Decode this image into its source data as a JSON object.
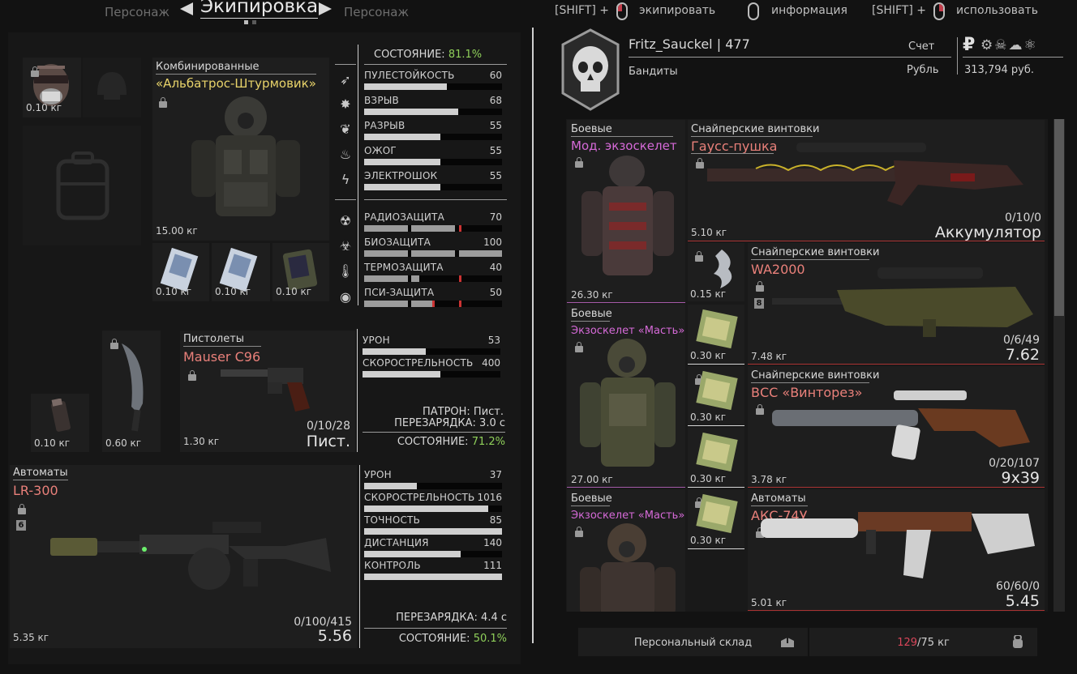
{
  "header": {
    "prev_tab": "Персонаж",
    "active_tab": "Экипировка",
    "next_tab": "Персонаж",
    "hints": [
      {
        "modifier": "[SHIFT] +",
        "label": "экипировать"
      },
      {
        "modifier": "",
        "label": "информация"
      },
      {
        "modifier": "[SHIFT] +",
        "label": "использовать"
      }
    ]
  },
  "equipment": {
    "mask_weight": "0.10 кг",
    "armor": {
      "category": "Комбинированные",
      "name": "«Альбатрос-Штурмовик»",
      "weight": "15.00 кг",
      "condition_label": "СОСТОЯНИЕ:",
      "condition_value": "81.1%",
      "stats": [
        {
          "label": "ПУЛЕСТОЙКОСТЬ",
          "value": "60",
          "fill": 0.6
        },
        {
          "label": "ВЗРЫВ",
          "value": "68",
          "fill": 0.68
        },
        {
          "label": "РАЗРЫВ",
          "value": "55",
          "fill": 0.55
        },
        {
          "label": "ОЖОГ",
          "value": "55",
          "fill": 0.55
        },
        {
          "label": "ЭЛЕКТРОШОК",
          "value": "55",
          "fill": 0.55
        }
      ],
      "protection": [
        {
          "label": "РАДИОЗАЩИТА",
          "value": "70"
        },
        {
          "label": "БИОЗАЩИТА",
          "value": "100"
        },
        {
          "label": "ТЕРМОЗАЩИТА",
          "value": "40"
        },
        {
          "label": "ПСИ-ЗАЩИТА",
          "value": "50"
        }
      ],
      "container_weights": [
        "0.10 кг",
        "0.10 кг",
        "0.10 кг"
      ]
    },
    "small_slots": {
      "grenade_weight": "0.10 кг",
      "knife_weight": "0.60 кг"
    },
    "pistol": {
      "category": "Пистолеты",
      "name": "Mauser C96",
      "weight": "1.30 кг",
      "ammo": "0/10/28",
      "caliber": "Пист.",
      "stats": [
        {
          "label": "УРОН",
          "value": "53",
          "fill": 0.46
        },
        {
          "label": "СКОРОСТРЕЛЬНОСТЬ",
          "value": "400",
          "fill": 0.56
        }
      ],
      "cartridge": "ПАТРОН: Пист.",
      "reload": "ПЕРЕЗАРЯДКА: 3.0 с",
      "condition_label": "СОСТОЯНИЕ:",
      "condition_value": "71.2%"
    },
    "rifle": {
      "category": "Автоматы",
      "name": "LR-300",
      "badge": "6",
      "weight": "5.35 кг",
      "ammo": "0/100/415",
      "caliber": "5.56",
      "stats": [
        {
          "label": "УРОН",
          "value": "37",
          "fill": 0.38
        },
        {
          "label": "СКОРОСТРЕЛЬНОСТЬ",
          "value": "1016",
          "fill": 0.9
        },
        {
          "label": "ТОЧНОСТЬ",
          "value": "85",
          "fill": 1.0
        },
        {
          "label": "ДИСТАНЦИЯ",
          "value": "140",
          "fill": 0.7
        },
        {
          "label": "КОНТРОЛЬ",
          "value": "111",
          "fill": 1.0
        }
      ],
      "reload": "ПЕРЕЗАРЯДКА: 4.4 с",
      "condition_label": "СОСТОЯНИЕ:",
      "condition_value": "50.1%"
    }
  },
  "profile": {
    "name": "Fritz_Sauckel",
    "separator": "|",
    "level": "477",
    "faction": "Бандиты",
    "account_label": "Счет",
    "currency_label": "Рубль",
    "money": "313,794 руб.",
    "currency_symbol": "₽"
  },
  "inventory": {
    "left": [
      {
        "category": "Боевые",
        "name": "Мод. экзоскелет",
        "weight": "26.30 кг"
      },
      {
        "category": "Боевые",
        "name": "Экзоскелет «Масть»",
        "weight": "27.00 кг"
      },
      {
        "category": "Боевые",
        "name": "Экзоскелет «Масть»",
        "weight": ""
      }
    ],
    "small": [
      {
        "weight": "0.15 кг"
      },
      {
        "weight": "0.30 кг"
      },
      {
        "weight": "0.30 кг"
      },
      {
        "weight": "0.30 кг"
      },
      {
        "weight": "0.30 кг"
      }
    ],
    "weapons": [
      {
        "category": "Снайперские винтовки",
        "name": "Гаусс-пушка",
        "weight": "5.10 кг",
        "ammo": "0/10/0",
        "caliber": "Аккумулятор"
      },
      {
        "category": "Снайперские винтовки",
        "name": "WA2000",
        "badge": "8",
        "weight": "7.48 кг",
        "ammo": "0/6/49",
        "caliber": "7.62"
      },
      {
        "category": "Снайперские винтовки",
        "name": "ВСС «Винторез»",
        "weight": "3.78 кг",
        "ammo": "0/20/107",
        "caliber": "9x39"
      },
      {
        "category": "Автоматы",
        "name": "АКС-74У",
        "weight": "5.01 кг",
        "ammo": "60/60/0",
        "caliber": "5.45"
      }
    ]
  },
  "footer": {
    "stash_label": "Персональный склад",
    "weight_current": "129",
    "weight_sep": "/",
    "weight_max": "75 кг"
  }
}
